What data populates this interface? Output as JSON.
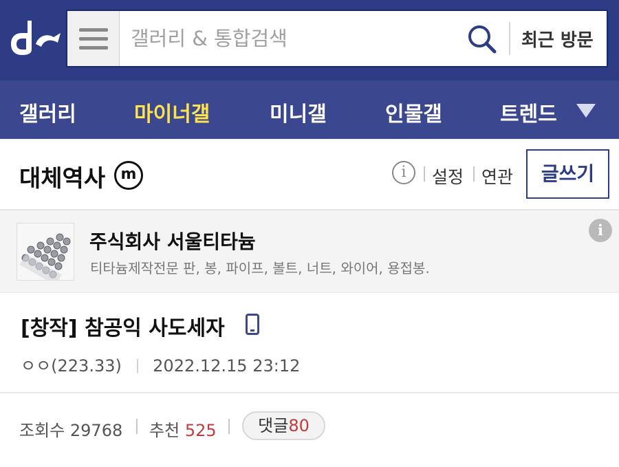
{
  "header": {
    "logo": "dc-logo-icon",
    "search": {
      "placeholder": "갤러리 & 통합검색",
      "value": ""
    },
    "recent_visits_label": "최근 방문"
  },
  "nav": {
    "items": [
      {
        "label": "갤러리",
        "active": false
      },
      {
        "label": "마이너갤",
        "active": true
      },
      {
        "label": "미니갤",
        "active": false
      },
      {
        "label": "인물갤",
        "active": false
      },
      {
        "label": "트렌드",
        "active": false
      }
    ],
    "expand_icon": "triangle-down-icon"
  },
  "gallery": {
    "title": "대체역사",
    "minor_badge": "m",
    "settings_label": "설정",
    "related_label": "연관",
    "write_label": "글쓰기"
  },
  "ad": {
    "title": "주식회사 서울티타늄",
    "description": "티타늄제작전문 판, 봉, 파이프, 볼트, 너트, 와이어, 용접봉."
  },
  "post": {
    "title": "[창작] 참공익 사도세자",
    "author": "ㅇㅇ(223.33)",
    "datetime": "2022.12.15 23:12",
    "views_label": "조회수",
    "views": "29768",
    "recommend_label": "추천",
    "recommend": "525",
    "comments_label": "댓글",
    "comments": "80"
  },
  "colors": {
    "header_bg": "#2d3d85",
    "nav_bg": "#3b4890",
    "nav_active": "#ffe34d",
    "accent_red": "#c23b3b"
  }
}
